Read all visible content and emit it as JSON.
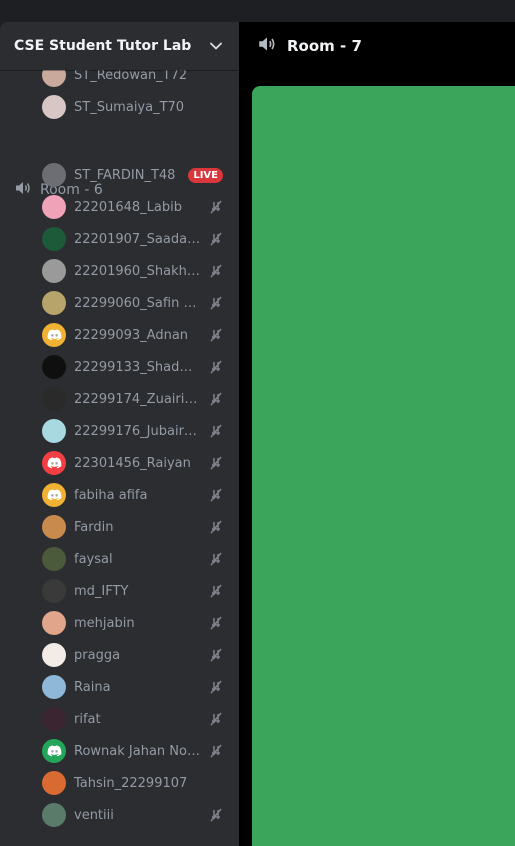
{
  "server": {
    "name": "CSE Student Tutor Lab"
  },
  "channels": {
    "room6": {
      "name": "Room - 6"
    },
    "room7": {
      "name": "Room - 7"
    }
  },
  "previous_members": [
    {
      "name": "ST_Redowan_T72",
      "avatar_color": "#c9a99b"
    },
    {
      "name": "ST_Sumaiya_T70",
      "avatar_color": "#d8c6c4"
    }
  ],
  "room6_members": [
    {
      "name": "ST_FARDIN_T48",
      "avatar_color": "#6d6e73",
      "badge": "LIVE"
    },
    {
      "name": "22201648_Labib",
      "avatar_color": "#f0a3b8",
      "muted": true
    },
    {
      "name": "22201907_Saadat S...",
      "avatar_color": "#1d5a3a",
      "muted": true
    },
    {
      "name": "22201960_Shakha...",
      "avatar_color": "#9a9a9a",
      "muted": true
    },
    {
      "name": "22299060_Safin A...",
      "avatar_color": "#b7a46b",
      "muted": true
    },
    {
      "name": "22299093_Adnan",
      "avatar_color": "#f0b232",
      "muted": true,
      "icon": "discord-logo-icon"
    },
    {
      "name": "22299133_Shadman",
      "avatar_color": "#0f0f0f",
      "muted": true
    },
    {
      "name": "22299174_Zuairia T...",
      "avatar_color": "#2a2a2a",
      "muted": true
    },
    {
      "name": "22299176_JubairZa...",
      "avatar_color": "#a8d8e0",
      "muted": true
    },
    {
      "name": "22301456_Raiyan",
      "avatar_color": "#f23f43",
      "muted": true,
      "icon": "discord-logo-icon"
    },
    {
      "name": "fabiha afifa",
      "avatar_color": "#f0b232",
      "muted": true,
      "icon": "discord-logo-icon"
    },
    {
      "name": "Fardin",
      "avatar_color": "#c98a4d",
      "muted": true
    },
    {
      "name": "faysal",
      "avatar_color": "#4a5a3a",
      "muted": true
    },
    {
      "name": "md_IFTY",
      "avatar_color": "#3a3a3a",
      "muted": true
    },
    {
      "name": "mehjabin",
      "avatar_color": "#e0a58a",
      "muted": true
    },
    {
      "name": "pragga",
      "avatar_color": "#f2ebe6",
      "muted": true
    },
    {
      "name": "Raina",
      "avatar_color": "#8fb8d8",
      "muted": true
    },
    {
      "name": "rifat",
      "avatar_color": "#3a2530",
      "muted": true
    },
    {
      "name": "Rownak Jahan Now...",
      "avatar_color": "#23a55a",
      "muted": true,
      "icon": "discord-logo-icon"
    },
    {
      "name": "Tahsin_22299107",
      "avatar_color": "#d86a32",
      "muted": false
    },
    {
      "name": "ventiii",
      "avatar_color": "#5a7a6a",
      "muted": true
    }
  ],
  "colors": {
    "stream_bg": "#3ba55c",
    "live_badge": "#da373c",
    "sidebar_bg": "#2b2d31"
  }
}
